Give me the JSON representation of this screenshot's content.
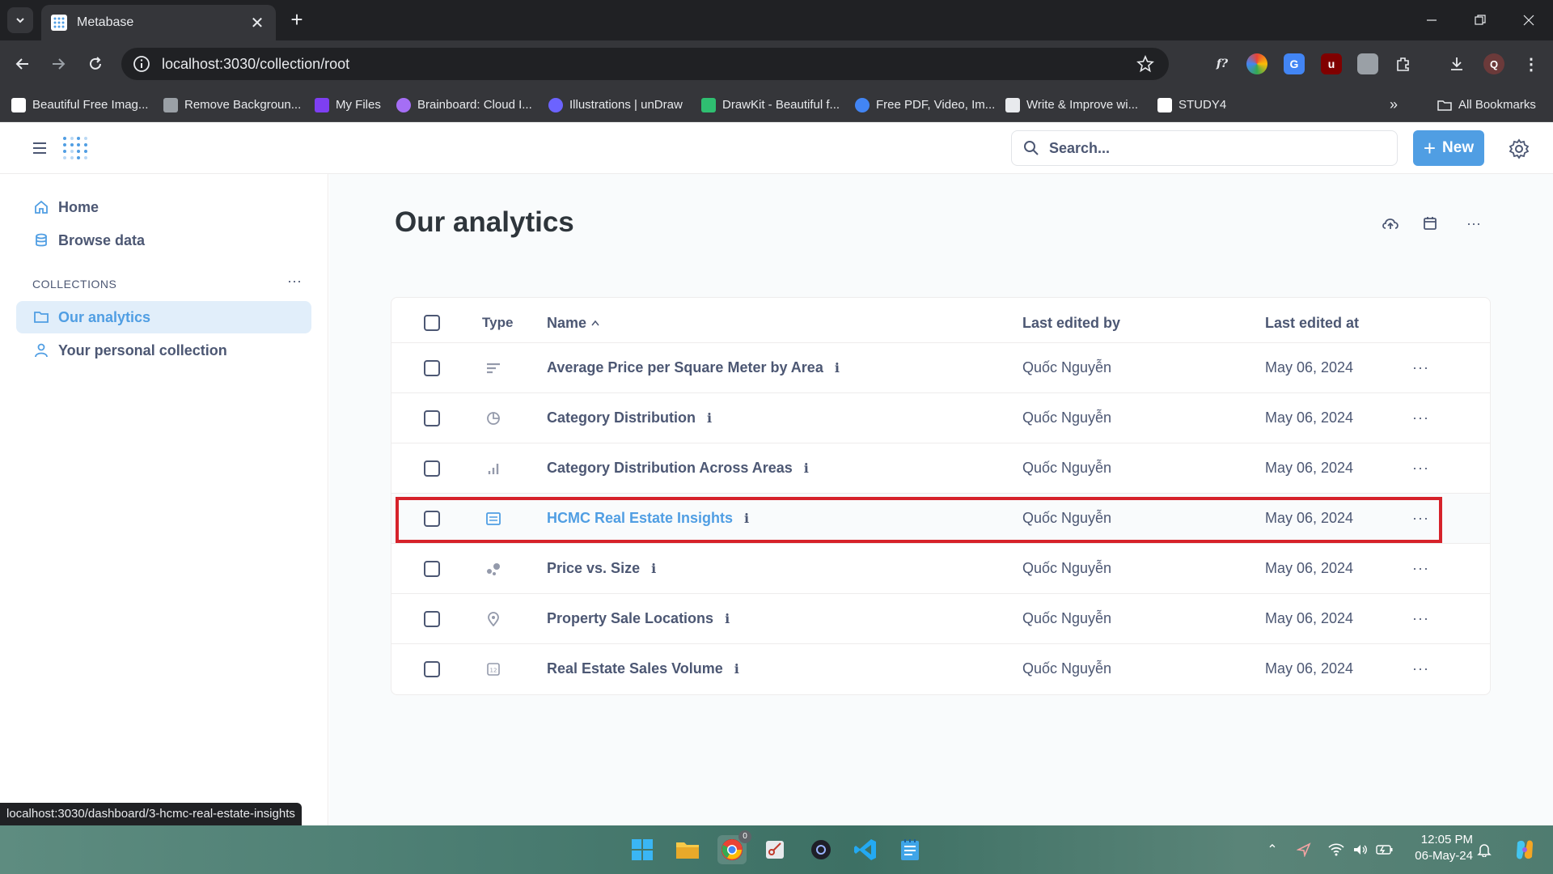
{
  "browser": {
    "tab_title": "Metabase",
    "url": "localhost:3030/collection/root",
    "status_url": "localhost:3030/dashboard/3-hcmc-real-estate-insights",
    "bookmarks": [
      {
        "label": "Beautiful Free Imag...",
        "icon": "unsplash-icon",
        "color": "#ffffff"
      },
      {
        "label": "Remove Backgroun...",
        "icon": "removebg-icon",
        "color": "#9aa0a6"
      },
      {
        "label": "My Files",
        "icon": "myfiles-icon",
        "color": "#7e3ff2"
      },
      {
        "label": "Brainboard: Cloud I...",
        "icon": "brainboard-icon",
        "color": "#a56ef5"
      },
      {
        "label": "Illustrations | unDraw",
        "icon": "undraw-icon",
        "color": "#6c63ff"
      },
      {
        "label": "DrawKit - Beautiful f...",
        "icon": "drawkit-icon",
        "color": "#2fbf71"
      },
      {
        "label": "Free PDF, Video, Im...",
        "icon": "pdf-icon",
        "color": "#4285f4"
      },
      {
        "label": "Write & Improve wi...",
        "icon": "write-icon",
        "color": "#e8eaed"
      },
      {
        "label": "STUDY4",
        "icon": "study4-icon",
        "color": "#ffffff"
      }
    ],
    "all_bookmarks": "All Bookmarks"
  },
  "app": {
    "search_placeholder": "Search...",
    "new_button": "New",
    "accent": "#509ee3"
  },
  "sidebar": {
    "home": "Home",
    "browse_data": "Browse data",
    "collections_header": "COLLECTIONS",
    "our_analytics": "Our analytics",
    "personal_collection": "Your personal collection"
  },
  "main": {
    "title": "Our analytics",
    "columns": {
      "type": "Type",
      "name": "Name",
      "last_edited_by": "Last edited by",
      "last_edited_at": "Last edited at"
    },
    "rows": [
      {
        "type_icon": "bar-horizontal-icon",
        "name": "Average Price per Square Meter by Area",
        "editor": "Quốc Nguyễn",
        "date": "May 06, 2024"
      },
      {
        "type_icon": "pie-chart-icon",
        "name": "Category Distribution",
        "editor": "Quốc Nguyễn",
        "date": "May 06, 2024"
      },
      {
        "type_icon": "bar-chart-icon",
        "name": "Category Distribution Across Areas",
        "editor": "Quốc Nguyễn",
        "date": "May 06, 2024"
      },
      {
        "type_icon": "dashboard-icon",
        "name": "HCMC Real Estate Insights",
        "editor": "Quốc Nguyễn",
        "date": "May 06, 2024"
      },
      {
        "type_icon": "scatter-icon",
        "name": "Price vs. Size",
        "editor": "Quốc Nguyễn",
        "date": "May 06, 2024"
      },
      {
        "type_icon": "map-pin-icon",
        "name": "Property Sale Locations",
        "editor": "Quốc Nguyễn",
        "date": "May 06, 2024"
      },
      {
        "type_icon": "number-icon",
        "name": "Real Estate Sales Volume",
        "editor": "Quốc Nguyễn",
        "date": "May 06, 2024"
      }
    ],
    "highlight_color": "#d6222a"
  },
  "taskbar": {
    "time": "12:05 PM",
    "date": "06-May-24",
    "chrome_badge": "0"
  }
}
